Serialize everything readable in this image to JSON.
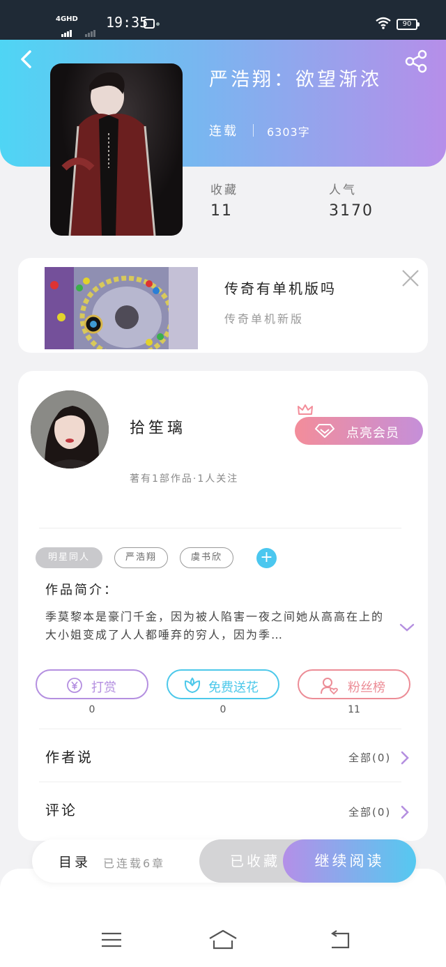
{
  "status_bar": {
    "network": "4GHD",
    "time": "19:35",
    "battery": "90"
  },
  "book": {
    "title": "严浩翔：欲望渐浓",
    "status": "连载",
    "words": "6303字",
    "stats": [
      {
        "label": "收藏",
        "value": "11"
      },
      {
        "label": "人气",
        "value": "3170"
      }
    ]
  },
  "ad": {
    "title": "传奇有单机版吗",
    "subtitle": "传奇单机新版"
  },
  "author": {
    "name": "拾笙璃",
    "meta": "著有1部作品·1人关注",
    "vip_button": "点亮会员"
  },
  "tags": [
    "明星同人",
    "严浩翔",
    "虞书欣"
  ],
  "intro": {
    "heading": "作品简介：",
    "text": "季莫黎本是豪门千金，因为被人陷害一夜之间她从高高在上的大小姐变成了人人都唾弃的穷人，因为季…"
  },
  "actions": [
    {
      "label": "打赏",
      "count": "0",
      "color": "#b48fe0"
    },
    {
      "label": "免费送花",
      "count": "0",
      "color": "#4cc8ea"
    },
    {
      "label": "粉丝榜",
      "count": "11",
      "color": "#ec8c96"
    }
  ],
  "rows": [
    {
      "title": "作者说",
      "link": "全部(0)"
    },
    {
      "title": "评论",
      "link": "全部(0)"
    }
  ],
  "bottom_bar": {
    "toc_label": "目录",
    "toc_count": "已连载6章",
    "fav_label": "已收藏",
    "read_label": "继续阅读"
  },
  "colors": {
    "accent_purple": "#b48fe8",
    "accent_cyan": "#55c9f0",
    "pink": "#f38d9a"
  }
}
